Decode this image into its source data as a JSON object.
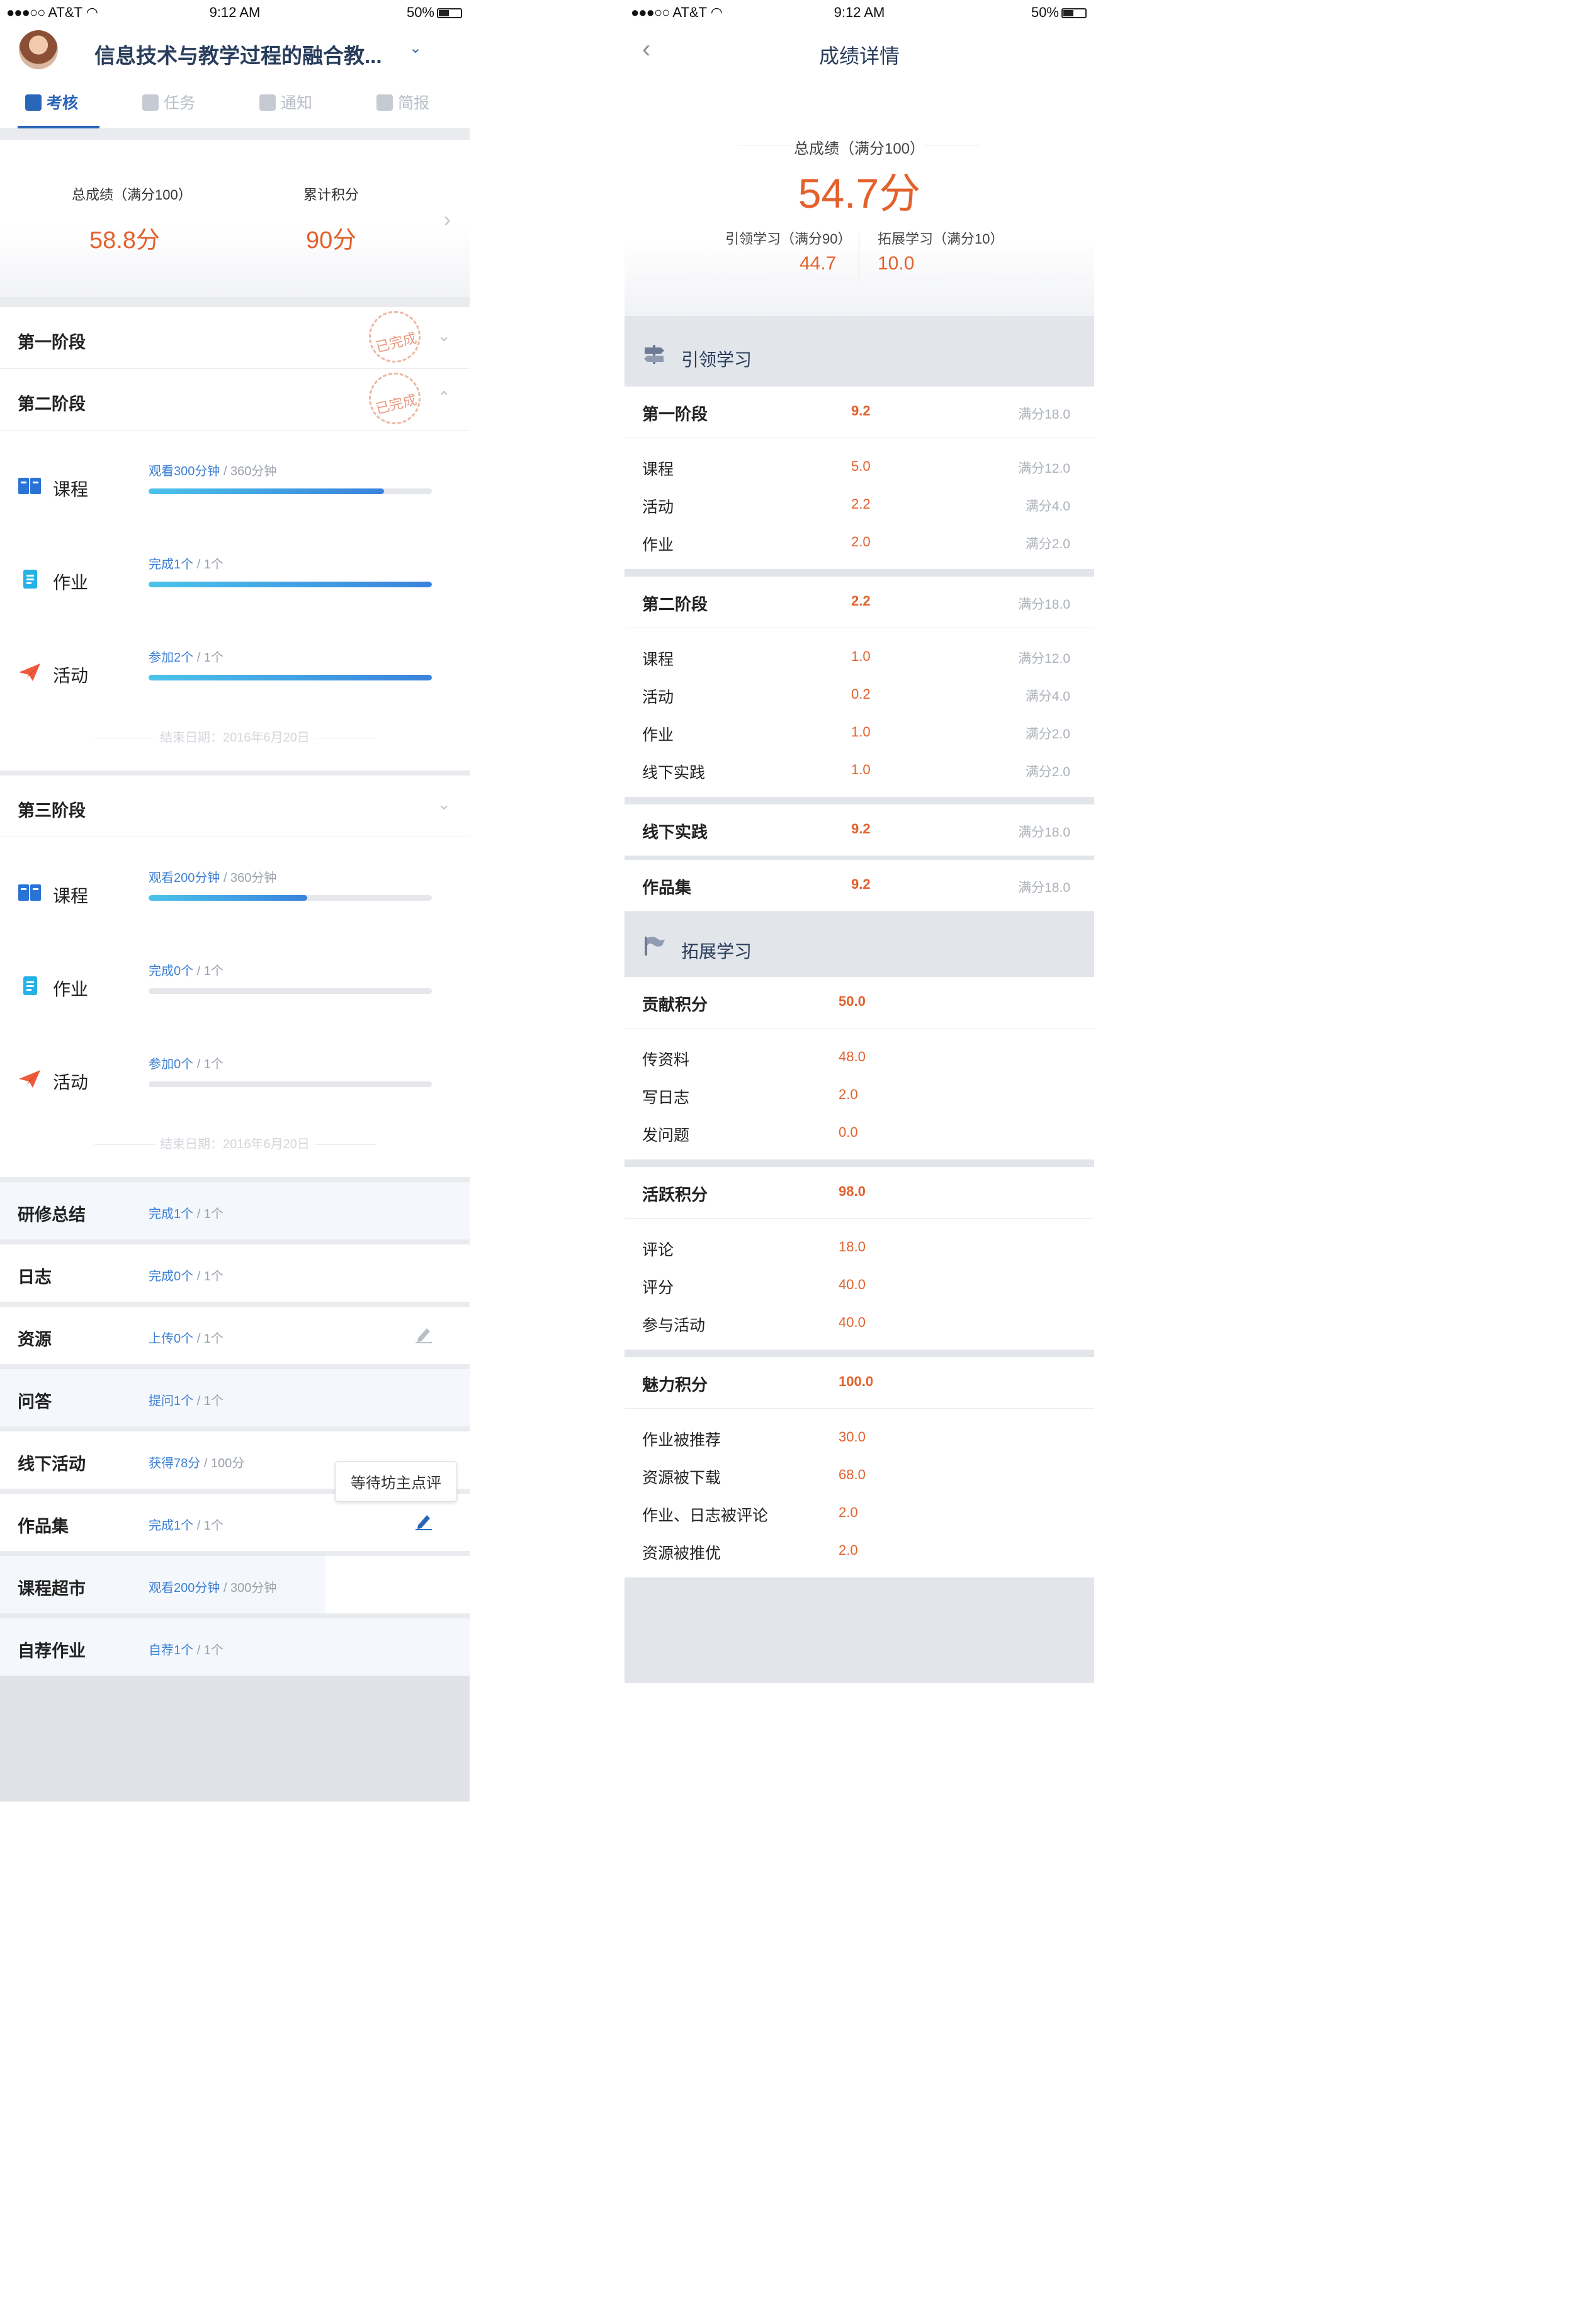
{
  "status": {
    "carrier": "AT&T",
    "time": "9:12 AM",
    "battery": "50%"
  },
  "left": {
    "course_title": "信息技术与教学过程的融合教...",
    "tabs": [
      "考核",
      "任务",
      "通知",
      "简报"
    ],
    "total_label": "总成绩（满分100）",
    "total_value": "58.8分",
    "points_label": "累计积分",
    "points_value": "90分",
    "stamp_text": "已完成",
    "stage1": "第一阶段",
    "stage2": "第二阶段",
    "stage3": "第三阶段",
    "s2": {
      "course": {
        "label": "课程",
        "done": "观看300分钟",
        "total": "/ 360分钟",
        "progress": 0.83
      },
      "homework": {
        "label": "作业",
        "done": "完成1个",
        "total": "/ 1个",
        "progress": 1.0
      },
      "activity": {
        "label": "活动",
        "done": "参加2个",
        "total": "/ 1个",
        "progress": 1.0
      },
      "end": "结束日期：2016年6月20日"
    },
    "s3": {
      "course": {
        "label": "课程",
        "done": "观看200分钟",
        "total": "/ 360分钟",
        "progress": 0.56
      },
      "homework": {
        "label": "作业",
        "done": "完成0个",
        "total": "/ 1个",
        "progress": 0
      },
      "activity": {
        "label": "活动",
        "done": "参加0个",
        "total": "/ 1个",
        "progress": 0
      },
      "end": "结束日期：2016年6月20日"
    },
    "rows": [
      {
        "title": "研修总结",
        "done": "完成1个",
        "total": "/ 1个"
      },
      {
        "title": "日志",
        "done": "完成0个",
        "total": "/ 1个"
      },
      {
        "title": "资源",
        "done": "上传0个",
        "total": "/ 1个"
      },
      {
        "title": "问答",
        "done": "提问1个",
        "total": "/ 1个"
      },
      {
        "title": "线下活动",
        "done": "获得78分",
        "total": "/ 100分"
      },
      {
        "title": "作品集",
        "done": "完成1个",
        "total": "/ 1个"
      },
      {
        "title": "课程超市",
        "done": "观看200分钟",
        "total": "/ 300分钟"
      },
      {
        "title": "自荐作业",
        "done": "自荐1个",
        "total": "/ 1个"
      }
    ],
    "tooltip": "等待坊主点评"
  },
  "right": {
    "title": "成绩详情",
    "total_label": "总成绩（满分100）",
    "total_value": "54.7分",
    "lead_label": "引领学习（满分90）",
    "lead_value": "44.7",
    "ext_label": "拓展学习（满分10）",
    "ext_value": "10.0",
    "sec1": "引领学习",
    "sec2": "拓展学习",
    "st1": {
      "name": "第一阶段",
      "value": "9.2",
      "max": "满分18.0",
      "items": [
        {
          "n": "课程",
          "v": "5.0",
          "m": "满分12.0"
        },
        {
          "n": "活动",
          "v": "2.2",
          "m": "满分4.0"
        },
        {
          "n": "作业",
          "v": "2.0",
          "m": "满分2.0"
        }
      ]
    },
    "st2": {
      "name": "第二阶段",
      "value": "2.2",
      "max": "满分18.0",
      "items": [
        {
          "n": "课程",
          "v": "1.0",
          "m": "满分12.0"
        },
        {
          "n": "活动",
          "v": "0.2",
          "m": "满分4.0"
        },
        {
          "n": "作业",
          "v": "1.0",
          "m": "满分2.0"
        },
        {
          "n": "线下实践",
          "v": "1.0",
          "m": "满分2.0"
        }
      ]
    },
    "offline": {
      "name": "线下实践",
      "value": "9.2",
      "max": "满分18.0"
    },
    "portfolio": {
      "name": "作品集",
      "value": "9.2",
      "max": "满分18.0"
    },
    "contrib": {
      "name": "贡献积分",
      "value": "50.0",
      "items": [
        {
          "n": "传资料",
          "v": "48.0"
        },
        {
          "n": "写日志",
          "v": "2.0"
        },
        {
          "n": "发问题",
          "v": "0.0"
        }
      ]
    },
    "active": {
      "name": "活跃积分",
      "value": "98.0",
      "items": [
        {
          "n": "评论",
          "v": "18.0"
        },
        {
          "n": "评分",
          "v": "40.0"
        },
        {
          "n": "参与活动",
          "v": "40.0"
        }
      ]
    },
    "charm": {
      "name": "魅力积分",
      "value": "100.0",
      "items": [
        {
          "n": "作业被推荐",
          "v": "30.0"
        },
        {
          "n": "资源被下载",
          "v": "68.0"
        },
        {
          "n": "作业、日志被评论",
          "v": "2.0"
        },
        {
          "n": "资源被推优",
          "v": "2.0"
        }
      ]
    }
  },
  "colors": {
    "accent": "#2a66b8",
    "score": "#e3612c",
    "link": "#3d80d4"
  }
}
